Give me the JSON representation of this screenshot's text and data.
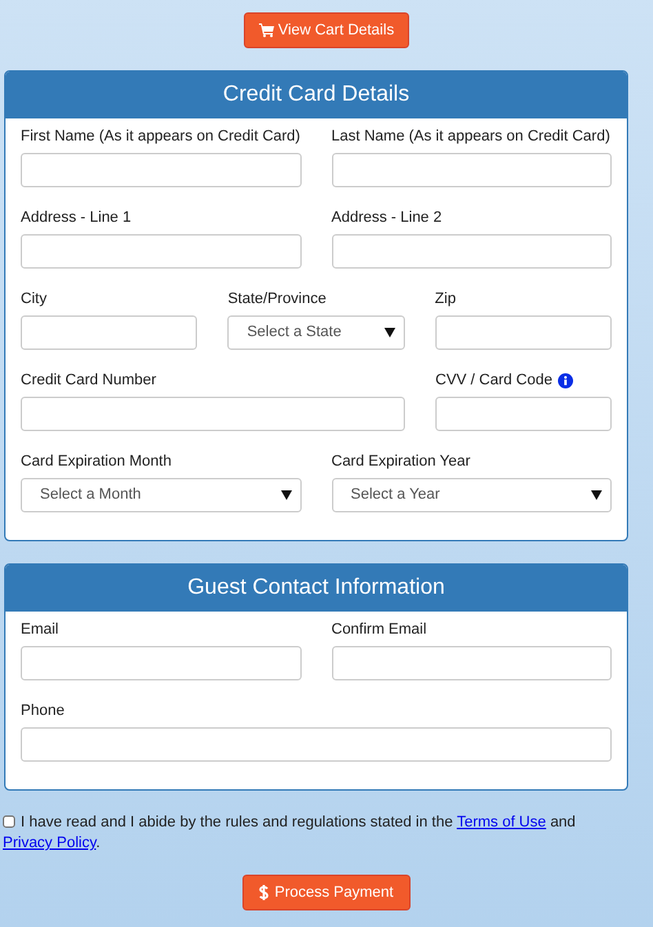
{
  "cart_button": {
    "label": "View Cart Details"
  },
  "panels": [
    {
      "title": "Credit Card Details",
      "rows": [
        {
          "kind": "halves",
          "fields": [
            {
              "label": "First Name (As it appears on Credit Card)",
              "kind": "text"
            },
            {
              "label": "Last Name (As it appears on Credit Card)",
              "kind": "text"
            }
          ]
        },
        {
          "kind": "halves",
          "fields": [
            {
              "label": "Address - Line 1",
              "kind": "text"
            },
            {
              "label": "Address - Line 2",
              "kind": "text"
            }
          ]
        },
        {
          "kind": "thirds",
          "fields": [
            {
              "label": "City",
              "kind": "text"
            },
            {
              "label": "State/Province",
              "kind": "select",
              "placeholder": "Select a State"
            },
            {
              "label": "Zip",
              "kind": "text"
            }
          ]
        },
        {
          "kind": "wide-narrow",
          "fields": [
            {
              "label": "Credit Card Number",
              "kind": "text"
            },
            {
              "label": "CVV / Card Code",
              "kind": "text",
              "info": true
            }
          ]
        },
        {
          "kind": "halves",
          "fields": [
            {
              "label": "Card Expiration Month",
              "kind": "select",
              "placeholder": "Select a Month"
            },
            {
              "label": "Card Expiration Year",
              "kind": "select",
              "placeholder": "Select a Year"
            }
          ]
        }
      ]
    },
    {
      "title": "Guest Contact Information",
      "rows": [
        {
          "kind": "halves",
          "fields": [
            {
              "label": "Email",
              "kind": "text"
            },
            {
              "label": "Confirm Email",
              "kind": "text"
            }
          ]
        },
        {
          "kind": "full",
          "fields": [
            {
              "label": "Phone",
              "kind": "text"
            }
          ]
        }
      ]
    }
  ],
  "agreement": {
    "checked": false,
    "text": "I have read and I abide by the rules and regulations stated in the",
    "link1": "Terms of Use",
    "middle": "and",
    "link2": "Privacy Policy",
    "end": "."
  },
  "pay_button": {
    "label": "Process Payment"
  }
}
